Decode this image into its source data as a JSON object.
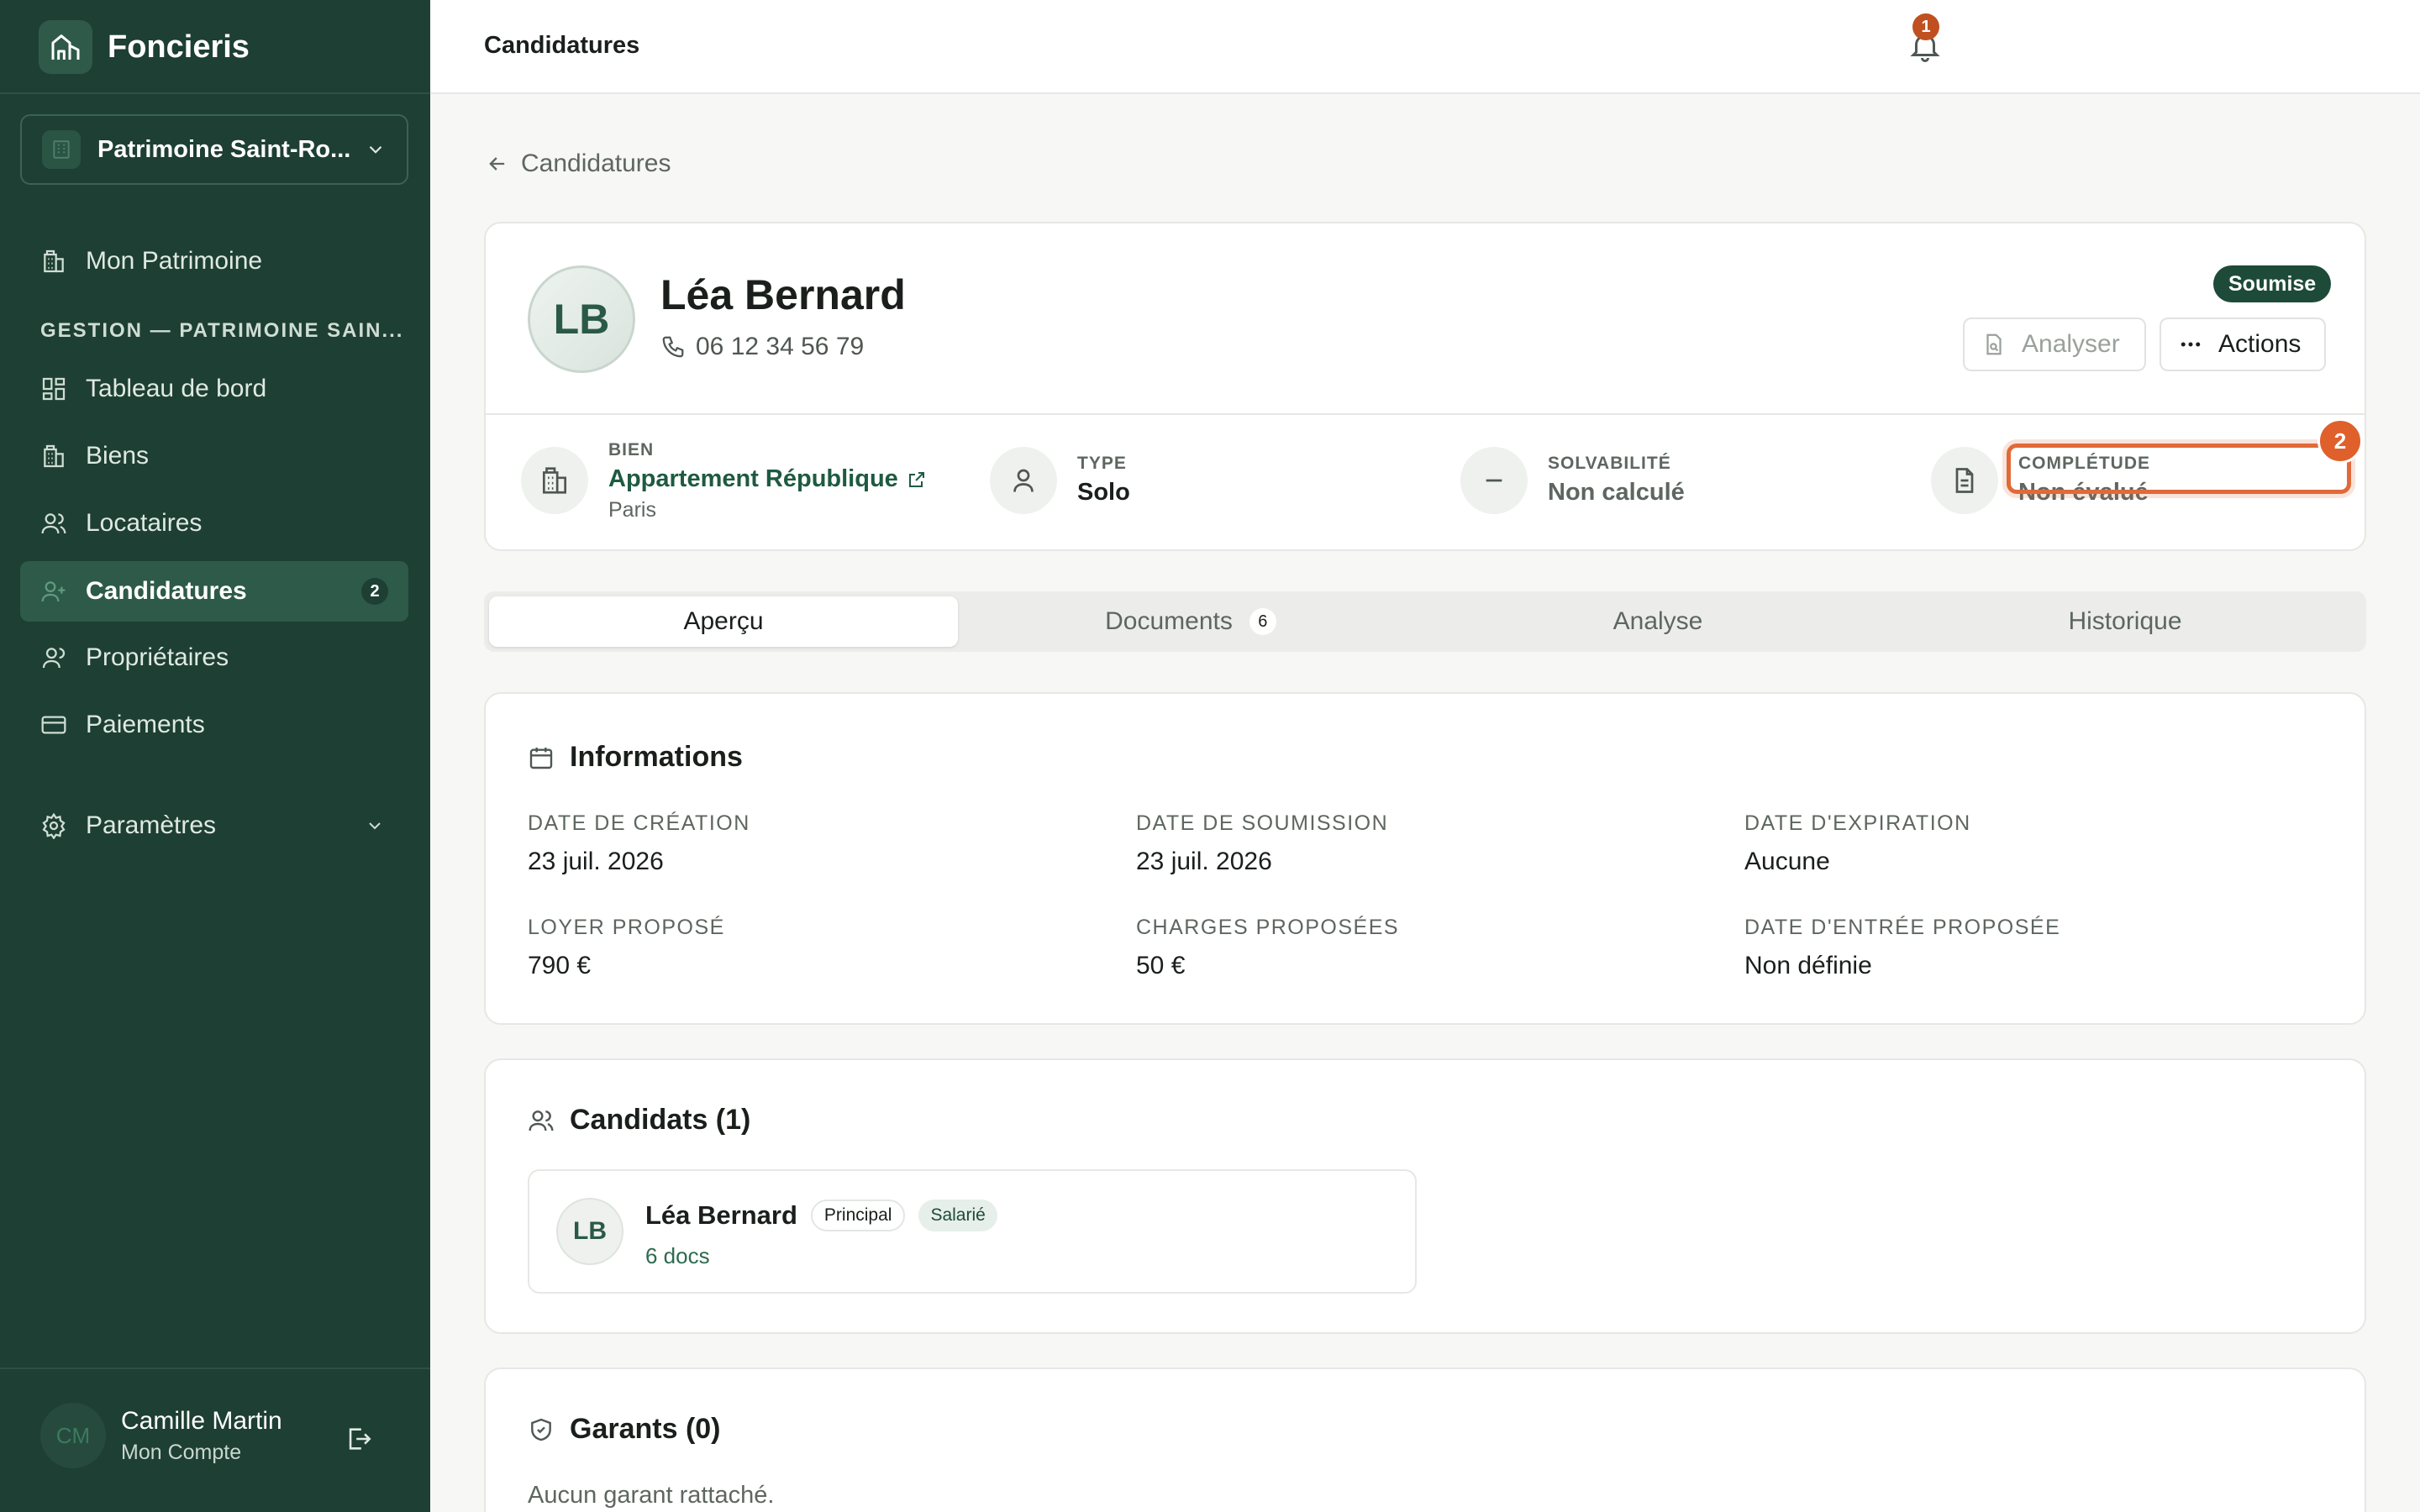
{
  "sidebar": {
    "brand": "Foncieris",
    "patrimoine": "Patrimoine Saint-Ro...",
    "section_label": "GESTION — PATRIMOINE SAIN...",
    "items": [
      {
        "label": "Mon Patrimoine",
        "icon": "building-icon"
      },
      {
        "label": "Tableau de bord",
        "icon": "dashboard-icon"
      },
      {
        "label": "Biens",
        "icon": "building-icon"
      },
      {
        "label": "Locataires",
        "icon": "user-icon"
      },
      {
        "label": "Candidatures",
        "icon": "user-plus-icon",
        "badge": "2",
        "active": true
      },
      {
        "label": "Propriétaires",
        "icon": "user-icon"
      },
      {
        "label": "Paiements",
        "icon": "card-icon"
      },
      {
        "label": "Paramètres",
        "icon": "gear-icon"
      }
    ],
    "user": {
      "initials": "CM",
      "name": "Camille Martin",
      "subtitle": "Mon Compte"
    }
  },
  "topbar": {
    "title": "Candidatures",
    "notifications": "1"
  },
  "back_link": "Candidatures",
  "candidate": {
    "initials": "LB",
    "name": "Léa Bernard",
    "phone": "06 12 34 56 79",
    "status": "Soumise",
    "analyser_label": "Analyser",
    "actions_label": "Actions"
  },
  "stats": [
    {
      "label": "BIEN",
      "value": "Appartement République",
      "sub": "Paris"
    },
    {
      "label": "TYPE",
      "value": "Solo"
    },
    {
      "label": "SOLVABILITÉ",
      "value": "Non calculé"
    },
    {
      "label": "COMPLÉTUDE",
      "value": "Non évalué"
    }
  ],
  "highlight_badge": "2",
  "tabs": [
    {
      "label": "Aperçu",
      "active": true
    },
    {
      "label": "Documents",
      "count": "6"
    },
    {
      "label": "Analyse"
    },
    {
      "label": "Historique"
    }
  ],
  "informations": {
    "title": "Informations",
    "fields": [
      {
        "label": "DATE DE CRÉATION",
        "value": "23 juil. 2026"
      },
      {
        "label": "DATE DE SOUMISSION",
        "value": "23 juil. 2026"
      },
      {
        "label": "DATE D'EXPIRATION",
        "value": "Aucune"
      },
      {
        "label": "LOYER PROPOSÉ",
        "value": "790 €"
      },
      {
        "label": "CHARGES PROPOSÉES",
        "value": "50 €"
      },
      {
        "label": "DATE D'ENTRÉE PROPOSÉE",
        "value": "Non définie"
      }
    ]
  },
  "candidats": {
    "title": "Candidats (1)",
    "list": [
      {
        "initials": "LB",
        "name": "Léa Bernard",
        "tags": [
          "Principal",
          "Salarié"
        ],
        "docs": "6 docs"
      }
    ]
  },
  "garants": {
    "title": "Garants (0)",
    "empty": "Aucun garant rattaché."
  },
  "colors": {
    "sidebar": "#1e3f33",
    "accent": "#1e4a3a",
    "highlight": "#e06a3a"
  }
}
